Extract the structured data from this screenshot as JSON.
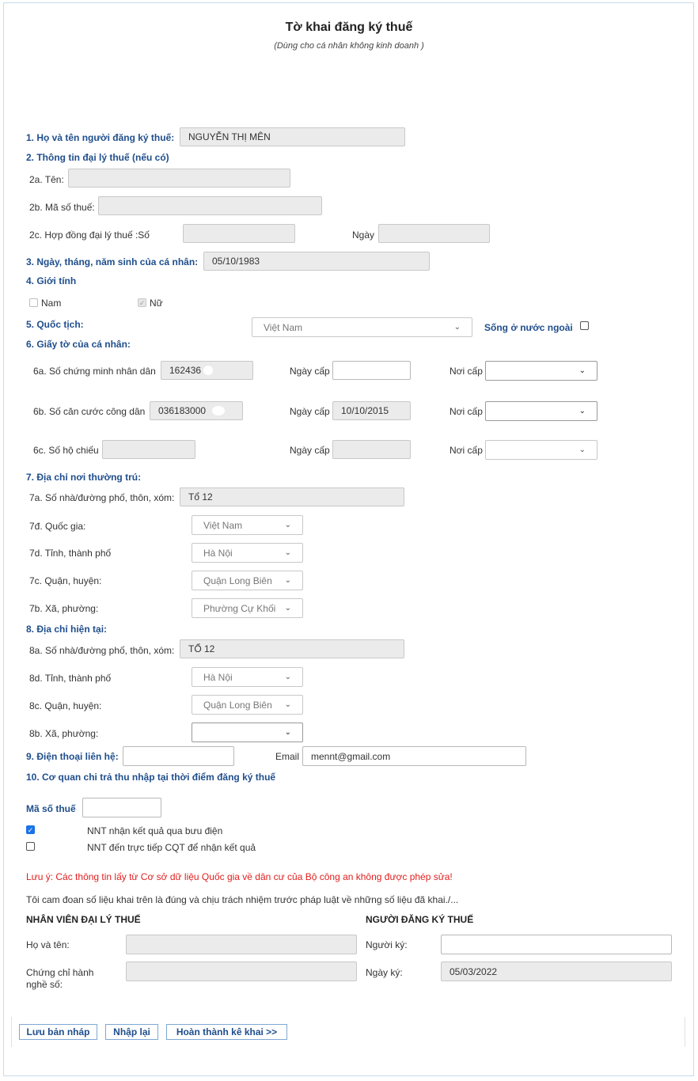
{
  "form": {
    "title": "Tờ khai đăng ký thuế",
    "subtitle": "(Dùng cho cá nhân không kinh doanh )"
  },
  "s1": {
    "label": "1. Họ và tên người đăng ký thuế:",
    "value": "NGUYỄN THỊ MÊN"
  },
  "s2": {
    "label": "2. Thông tin đại lý thuế (nếu có)",
    "name_label": "2a. Tên:",
    "name_value": "",
    "tax_label": "2b. Mã số thuế:",
    "tax_value": "",
    "contract_label": "2c. Hợp đồng đại lý thuế :Số",
    "contract_value": "",
    "date_label": "Ngày",
    "date_value": ""
  },
  "s3": {
    "label": "3. Ngày, tháng, năm sinh của cá nhân:",
    "value": "05/10/1983"
  },
  "s4": {
    "label": "4. Giới tính",
    "male": "Nam",
    "female": "Nữ",
    "male_checked": false,
    "female_checked": true
  },
  "s5": {
    "label": "5. Quốc tịch:",
    "value": "Việt Nam",
    "abroad_label": "Sống ở nước ngoài",
    "abroad_checked": false
  },
  "s6": {
    "label": "6. Giấy tờ của cá nhân:",
    "cmnd_label": "6a. Số chứng minh nhân dân",
    "cmnd_value": "162436",
    "cccd_label": "6b. Số căn cước công dân",
    "cccd_value": "036183000",
    "passport_label": "6c. Số hộ chiếu",
    "passport_value": "",
    "issue_date_label": "Ngày cấp",
    "issue_place_label": "Nơi cấp",
    "cmnd_issue_date": "",
    "cccd_issue_date": "10/10/2015",
    "passport_issue_date": "",
    "cmnd_issue_place": "",
    "cccd_issue_place": "",
    "passport_issue_place": ""
  },
  "s7": {
    "label": "7. Địa chỉ nơi thường trú:",
    "street_label": "7a. Số nhà/đường phố, thôn, xóm:",
    "street_value": "Tổ 12",
    "country_label": "7đ. Quốc gia:",
    "country_value": "Việt Nam",
    "province_label": "7d. Tỉnh, thành phố",
    "province_value": "Hà Nội",
    "district_label": "7c. Quận, huyện:",
    "district_value": "Quận Long Biên",
    "ward_label": "7b. Xã, phường:",
    "ward_value": "Phường Cự Khối"
  },
  "s8": {
    "label": "8. Địa chỉ hiện tại:",
    "street_label": "8a. Số nhà/đường phố, thôn, xóm:",
    "street_value": "TỔ 12",
    "province_label": "8d. Tỉnh, thành phố",
    "province_value": "Hà Nội",
    "district_label": "8c. Quận, huyện:",
    "district_value": "Quận Long Biên",
    "ward_label": "8b. Xã, phường:",
    "ward_value": ""
  },
  "s9": {
    "phone_label": "9. Điện thoại liên hệ:",
    "phone_value": "",
    "email_label": "Email",
    "email_value": "mennt@gmail.com"
  },
  "s10": {
    "label": "10. Cơ quan chi trả thu nhập tại thời điểm đăng ký thuế",
    "tax_label": "Mã số thuế",
    "tax_value": "",
    "post_label": "NNT nhận kết quả qua bưu điện",
    "post_checked": true,
    "direct_label": "NNT đến trực tiếp CQT để nhận kết quả",
    "direct_checked": false
  },
  "notes": {
    "warning": "Lưu ý: Các thông tin lấy từ Cơ sở dữ liệu Quốc gia về dân cư của Bộ công an không được phép sửa!",
    "commit": "Tôi cam đoan số liệu khai trên là đúng và chịu trách nhiệm trước pháp luật về những số liệu đã khai./..."
  },
  "agent": {
    "title": "NHÂN VIÊN ĐẠI LÝ THUẾ",
    "name_label": "Họ và tên:",
    "name_value": "",
    "cert_label_1": "Chứng chỉ hành",
    "cert_label_2": "nghề số:",
    "cert_value": ""
  },
  "registrant": {
    "title": "NGƯỜI ĐĂNG KÝ THUẾ",
    "signer_label": "Người ký:",
    "signer_value": "",
    "date_label": "Ngày ký:",
    "date_value": "05/03/2022"
  },
  "buttons": {
    "save_draft": "Lưu bản nháp",
    "reset": "Nhập lại",
    "complete": "Hoàn thành kê khai >>"
  },
  "icons": {
    "chevron": "chevron-down-icon",
    "check": "check-icon"
  },
  "colors": {
    "section": "#1f4e8c",
    "warning": "#e01e1e",
    "checkbox_checked": "#1a73e8",
    "button_border": "#7ea8d3"
  }
}
